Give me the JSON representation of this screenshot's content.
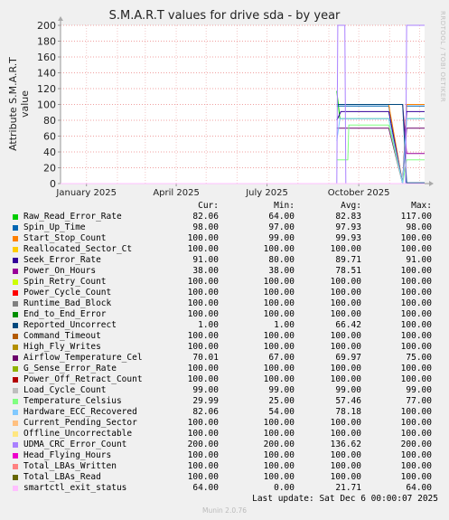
{
  "title": "S.M.A.R.T values for drive sda - by year",
  "y_axis_label": "Attribute S.M.A.R.T value",
  "side_text": "RRDTOOL / TOBI OETIKER",
  "legend_headers": {
    "cur": "Cur:",
    "min": "Min:",
    "avg": "Avg:",
    "max": "Max:"
  },
  "rows": [
    {
      "name": "Raw_Read_Error_Rate",
      "color": "#00cc00",
      "cur": "82.06",
      "min": "64.00",
      "avg": "82.83",
      "max": "117.00"
    },
    {
      "name": "Spin_Up_Time",
      "color": "#0066b3",
      "cur": "98.00",
      "min": "97.00",
      "avg": "97.93",
      "max": "98.00"
    },
    {
      "name": "Start_Stop_Count",
      "color": "#ff8000",
      "cur": "100.00",
      "min": "99.00",
      "avg": "99.93",
      "max": "100.00"
    },
    {
      "name": "Reallocated_Sector_Ct",
      "color": "#ffcc00",
      "cur": "100.00",
      "min": "100.00",
      "avg": "100.00",
      "max": "100.00"
    },
    {
      "name": "Seek_Error_Rate",
      "color": "#330099",
      "cur": "91.00",
      "min": "80.00",
      "avg": "89.71",
      "max": "91.00"
    },
    {
      "name": "Power_On_Hours",
      "color": "#990099",
      "cur": "38.00",
      "min": "38.00",
      "avg": "78.51",
      "max": "100.00"
    },
    {
      "name": "Spin_Retry_Count",
      "color": "#ccff00",
      "cur": "100.00",
      "min": "100.00",
      "avg": "100.00",
      "max": "100.00"
    },
    {
      "name": "Power_Cycle_Count",
      "color": "#ff0000",
      "cur": "100.00",
      "min": "100.00",
      "avg": "100.00",
      "max": "100.00"
    },
    {
      "name": "Runtime_Bad_Block",
      "color": "#808080",
      "cur": "100.00",
      "min": "100.00",
      "avg": "100.00",
      "max": "100.00"
    },
    {
      "name": "End_to_End_Error",
      "color": "#008f00",
      "cur": "100.00",
      "min": "100.00",
      "avg": "100.00",
      "max": "100.00"
    },
    {
      "name": "Reported_Uncorrect",
      "color": "#00487d",
      "cur": "1.00",
      "min": "1.00",
      "avg": "66.42",
      "max": "100.00"
    },
    {
      "name": "Command_Timeout",
      "color": "#b35a00",
      "cur": "100.00",
      "min": "100.00",
      "avg": "100.00",
      "max": "100.00"
    },
    {
      "name": "High_Fly_Writes",
      "color": "#b38f00",
      "cur": "100.00",
      "min": "100.00",
      "avg": "100.00",
      "max": "100.00"
    },
    {
      "name": "Airflow_Temperature_Cel",
      "color": "#6b006b",
      "cur": "70.01",
      "min": "67.00",
      "avg": "69.97",
      "max": "75.00"
    },
    {
      "name": "G_Sense_Error_Rate",
      "color": "#8fb300",
      "cur": "100.00",
      "min": "100.00",
      "avg": "100.00",
      "max": "100.00"
    },
    {
      "name": "Power_Off_Retract_Count",
      "color": "#b30000",
      "cur": "100.00",
      "min": "100.00",
      "avg": "100.00",
      "max": "100.00"
    },
    {
      "name": "Load_Cycle_Count",
      "color": "#bebebe",
      "cur": "99.00",
      "min": "99.00",
      "avg": "99.00",
      "max": "99.00"
    },
    {
      "name": "Temperature_Celsius",
      "color": "#80ff80",
      "cur": "29.99",
      "min": "25.00",
      "avg": "57.46",
      "max": "77.00"
    },
    {
      "name": "Hardware_ECC_Recovered",
      "color": "#80c9ff",
      "cur": "82.06",
      "min": "54.00",
      "avg": "78.18",
      "max": "100.00"
    },
    {
      "name": "Current_Pending_Sector",
      "color": "#ffc080",
      "cur": "100.00",
      "min": "100.00",
      "avg": "100.00",
      "max": "100.00"
    },
    {
      "name": "Offline_Uncorrectable",
      "color": "#ffe680",
      "cur": "100.00",
      "min": "100.00",
      "avg": "100.00",
      "max": "100.00"
    },
    {
      "name": "UDMA_CRC_Error_Count",
      "color": "#aa80ff",
      "cur": "200.00",
      "min": "200.00",
      "avg": "136.62",
      "max": "200.00"
    },
    {
      "name": "Head_Flying_Hours",
      "color": "#ee00cc",
      "cur": "100.00",
      "min": "100.00",
      "avg": "100.00",
      "max": "100.00"
    },
    {
      "name": "Total_LBAs_Written",
      "color": "#ff8080",
      "cur": "100.00",
      "min": "100.00",
      "avg": "100.00",
      "max": "100.00"
    },
    {
      "name": "Total_LBAs_Read",
      "color": "#666600",
      "cur": "100.00",
      "min": "100.00",
      "avg": "100.00",
      "max": "100.00"
    },
    {
      "name": "smartctl_exit_status",
      "color": "#ffbfff",
      "cur": "64.00",
      "min": "0.00",
      "avg": "21.71",
      "max": "64.00"
    }
  ],
  "last_update": "Last update: Sat Dec  6 00:00:07 2025",
  "munin_version": "Munin 2.0.76",
  "chart_data": {
    "type": "line",
    "title": "S.M.A.R.T values for drive sda - by year",
    "ylabel": "Attribute S.M.A.R.T value",
    "ylim": [
      0,
      200
    ],
    "y_ticks": [
      0,
      20,
      40,
      60,
      80,
      100,
      120,
      140,
      160,
      180,
      200
    ],
    "x_tick_labels": [
      "January 2025",
      "April 2025",
      "July 2025",
      "October 2025"
    ],
    "x_range": [
      "2024-12-06",
      "2025-12-06"
    ],
    "x_ticks": [
      "2025-01-01",
      "2025-04-01",
      "2025-07-01",
      "2025-10-01"
    ],
    "grid": true,
    "series": [
      {
        "name": "Raw_Read_Error_Rate",
        "points": [
          [
            "2025-09-09",
            117
          ],
          [
            "2025-09-12",
            82
          ],
          [
            "2025-10-31",
            82
          ],
          [
            "2025-11-14",
            0
          ],
          [
            "2025-11-18",
            82
          ],
          [
            "2025-12-06",
            82
          ]
        ]
      },
      {
        "name": "Spin_Up_Time",
        "points": [
          [
            "2025-09-09",
            98
          ],
          [
            "2025-10-31",
            98
          ],
          [
            "2025-11-14",
            0
          ],
          [
            "2025-11-18",
            98
          ],
          [
            "2025-12-06",
            98
          ]
        ]
      },
      {
        "name": "Start_Stop_Count",
        "points": [
          [
            "2025-09-09",
            100
          ],
          [
            "2025-10-31",
            100
          ],
          [
            "2025-11-14",
            0
          ],
          [
            "2025-11-18",
            100
          ],
          [
            "2025-12-06",
            100
          ]
        ]
      },
      {
        "name": "Seek_Error_Rate",
        "points": [
          [
            "2025-09-09",
            80
          ],
          [
            "2025-09-13",
            91
          ],
          [
            "2025-10-31",
            91
          ],
          [
            "2025-11-14",
            0
          ],
          [
            "2025-11-18",
            91
          ],
          [
            "2025-12-06",
            91
          ]
        ]
      },
      {
        "name": "Power_On_Hours",
        "points": [
          [
            "2025-09-09",
            100
          ],
          [
            "2025-11-14",
            100
          ],
          [
            "2025-11-18",
            38
          ],
          [
            "2025-12-06",
            38
          ]
        ]
      },
      {
        "name": "Reported_Uncorrect",
        "points": [
          [
            "2025-09-09",
            100
          ],
          [
            "2025-11-14",
            100
          ],
          [
            "2025-11-18",
            1
          ],
          [
            "2025-12-06",
            1
          ]
        ]
      },
      {
        "name": "Airflow_Temperature_Cel",
        "points": [
          [
            "2025-09-09",
            70
          ],
          [
            "2025-10-31",
            70
          ],
          [
            "2025-11-14",
            0
          ],
          [
            "2025-11-18",
            70
          ],
          [
            "2025-12-06",
            70
          ]
        ]
      },
      {
        "name": "Temperature_Celsius",
        "points": [
          [
            "2025-09-09",
            30
          ],
          [
            "2025-09-20",
            30
          ],
          [
            "2025-09-21",
            74
          ],
          [
            "2025-10-31",
            74
          ],
          [
            "2025-11-14",
            0
          ],
          [
            "2025-11-18",
            30
          ],
          [
            "2025-12-06",
            30
          ]
        ]
      },
      {
        "name": "Hardware_ECC_Recovered",
        "points": [
          [
            "2025-09-09",
            54
          ],
          [
            "2025-09-12",
            82
          ],
          [
            "2025-10-31",
            82
          ],
          [
            "2025-11-14",
            0
          ],
          [
            "2025-11-18",
            82
          ],
          [
            "2025-12-06",
            82
          ]
        ]
      },
      {
        "name": "UDMA_CRC_Error_Count",
        "points": [
          [
            "2024-12-06",
            0
          ],
          [
            "2025-09-09",
            0
          ],
          [
            "2025-09-10",
            200
          ],
          [
            "2025-09-17",
            200
          ],
          [
            "2025-09-18",
            0
          ],
          [
            "2025-11-17",
            0
          ],
          [
            "2025-11-18",
            200
          ],
          [
            "2025-12-06",
            200
          ]
        ]
      },
      {
        "name": "smartctl_exit_status",
        "points": [
          [
            "2024-12-06",
            0
          ],
          [
            "2025-12-06",
            0
          ]
        ]
      }
    ]
  }
}
